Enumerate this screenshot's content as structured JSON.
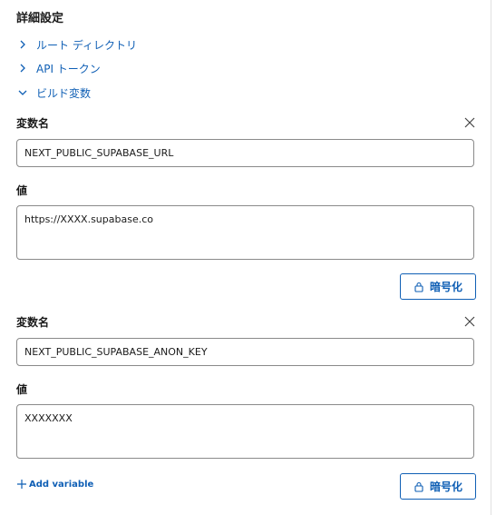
{
  "panel": {
    "title": "詳細設定"
  },
  "sections": [
    {
      "label": "ルート ディレクトリ",
      "expanded": false
    },
    {
      "label": "API トークン",
      "expanded": false
    },
    {
      "label": "ビルド変数",
      "expanded": true
    }
  ],
  "variables": [
    {
      "name_label": "変数名",
      "name_value": "NEXT_PUBLIC_SUPABASE_URL",
      "value_label": "値",
      "value_value": "https://XXXX.supabase.co",
      "encrypt_label": "暗号化"
    },
    {
      "name_label": "変数名",
      "name_value": "NEXT_PUBLIC_SUPABASE_ANON_KEY",
      "value_label": "値",
      "value_value": "XXXXXXX",
      "encrypt_label": "暗号化"
    }
  ],
  "add_variable_label": "Add variable",
  "colors": {
    "accent": "#0f5fb5",
    "border": "#8a8a8a",
    "text": "#1b1b1b"
  }
}
